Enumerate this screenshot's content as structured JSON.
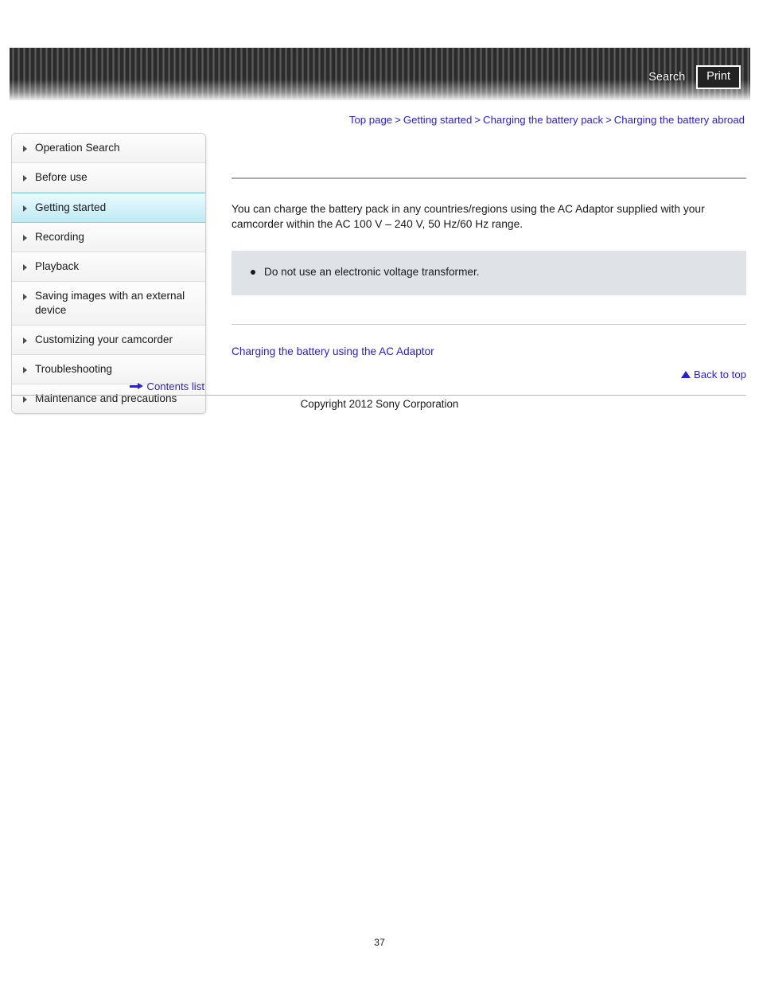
{
  "header": {
    "search_label": "Search",
    "print_label": "Print"
  },
  "breadcrumb": {
    "items": [
      {
        "label": "Top page"
      },
      {
        "label": "Getting started"
      },
      {
        "label": "Charging the battery pack"
      },
      {
        "label": "Charging the battery abroad"
      }
    ],
    "separator": ">"
  },
  "sidebar": {
    "items": [
      {
        "label": "Operation Search",
        "active": false
      },
      {
        "label": "Before use",
        "active": false
      },
      {
        "label": "Getting started",
        "active": true
      },
      {
        "label": "Recording",
        "active": false
      },
      {
        "label": "Playback",
        "active": false
      },
      {
        "label": "Saving images with an external device",
        "active": false
      },
      {
        "label": "Customizing your camcorder",
        "active": false
      },
      {
        "label": "Troubleshooting",
        "active": false
      },
      {
        "label": "Maintenance and precautions",
        "active": false
      }
    ],
    "contents_list_label": "Contents list"
  },
  "main": {
    "body_text": "You can charge the battery pack in any countries/regions using the AC Adaptor supplied with your camcorder within the AC 100 V – 240 V, 50 Hz/60 Hz range.",
    "note_items": [
      {
        "text": "Do not use an electronic voltage transformer."
      }
    ],
    "related_link_label": "Charging the battery using the AC Adaptor",
    "back_to_top_label": "Back to top"
  },
  "footer": {
    "copyright": "Copyright 2012 Sony Corporation",
    "page_number": "37"
  },
  "colors": {
    "link": "#2b20c9",
    "note_background": "#dfe2e7",
    "active_highlight": "#bfeaf5",
    "banner_dark": "#2b2b2b"
  }
}
